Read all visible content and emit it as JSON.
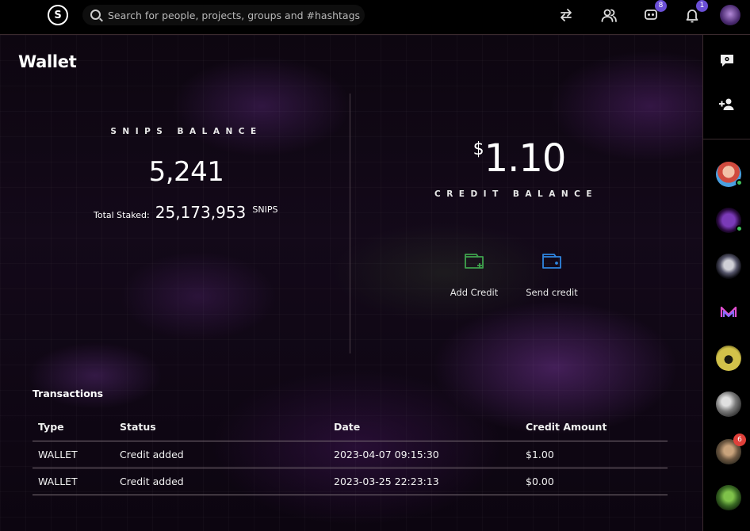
{
  "topbar": {
    "logo_letter": "S",
    "search_placeholder": "Search for people, projects, groups and #hashtags",
    "messages_badge": "8",
    "notifications_badge": "1"
  },
  "page": {
    "title": "Wallet"
  },
  "snips": {
    "label": "SNIPS BALANCE",
    "balance": "5,241",
    "staked_label": "Total Staked:",
    "staked_value": "25,173,953",
    "staked_unit": "SNIPS"
  },
  "credit": {
    "currency": "$",
    "amount": "1.10",
    "label": "CREDIT BALANCE",
    "add_label": "Add Credit",
    "send_label": "Send credit"
  },
  "transactions": {
    "title": "Transactions",
    "columns": [
      "Type",
      "Status",
      "Date",
      "Credit Amount"
    ],
    "rows": [
      [
        "WALLET",
        "Credit added",
        "2023-04-07 09:15:30",
        "$1.00"
      ],
      [
        "WALLET",
        "Credit added",
        "2023-03-25 22:23:13",
        "$0.00"
      ]
    ]
  },
  "rail": {
    "contacts": [
      {
        "online": true,
        "badge": ""
      },
      {
        "online": true,
        "badge": ""
      },
      {
        "online": false,
        "badge": ""
      },
      {
        "online": false,
        "badge": ""
      },
      {
        "online": false,
        "badge": ""
      },
      {
        "online": false,
        "badge": ""
      },
      {
        "online": false,
        "badge": "6"
      },
      {
        "online": false,
        "badge": ""
      }
    ]
  },
  "colors": {
    "accent_badge": "#6b4fd6",
    "add_credit_icon": "#3fa34d",
    "send_credit_icon": "#2f86e0",
    "online": "#41c15b",
    "alert_badge": "#e0403a"
  }
}
